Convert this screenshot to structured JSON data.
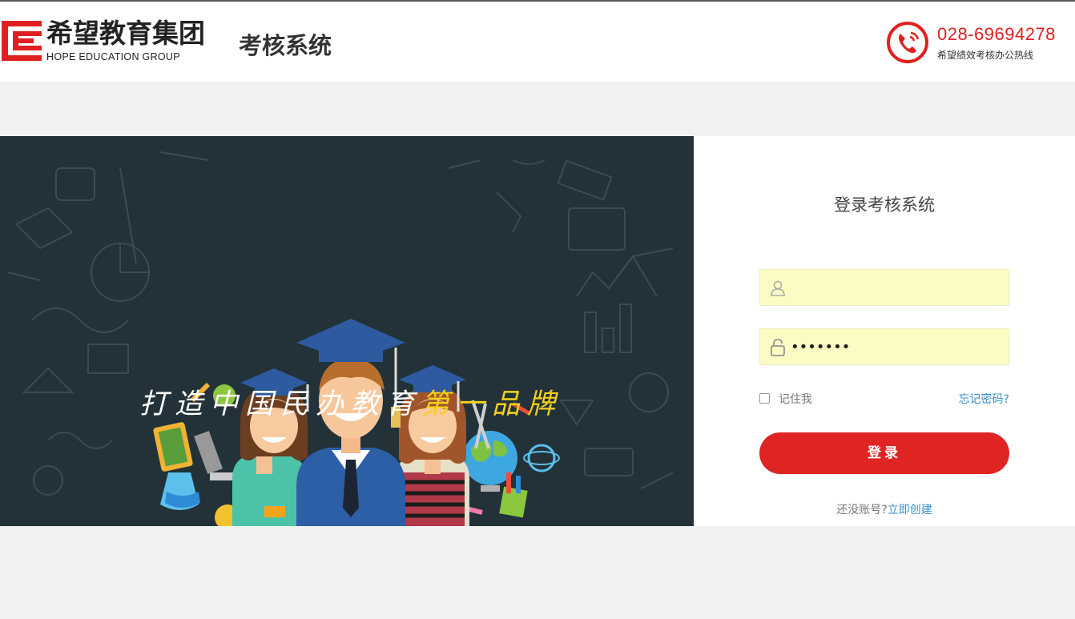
{
  "header": {
    "logo_cn": "希望教育集团",
    "logo_en": "HOPE EDUCATION GROUP",
    "system_title": "考核系统",
    "hotline_number": "028-69694278",
    "hotline_label": "希望绩效考核办公热线",
    "phone_icon": "phone-circle-icon"
  },
  "banner": {
    "slogan_main": "打造中国民办教育",
    "slogan_highlight": "第一品牌"
  },
  "login": {
    "title": "登录考核系统",
    "username_value": "",
    "password_value": "•••••••",
    "remember_label": "记住我",
    "forgot_label": "忘记密码?",
    "submit_label": "登录",
    "register_prompt": "还没账号?",
    "register_link": "立即创建"
  },
  "colors": {
    "brand_red": "#e02020",
    "button_red": "#df2424",
    "banner_bg": "#223238",
    "input_bg": "#fbfcc4",
    "link_blue": "#3a8fc8",
    "slogan_yellow": "#f7d11b"
  }
}
